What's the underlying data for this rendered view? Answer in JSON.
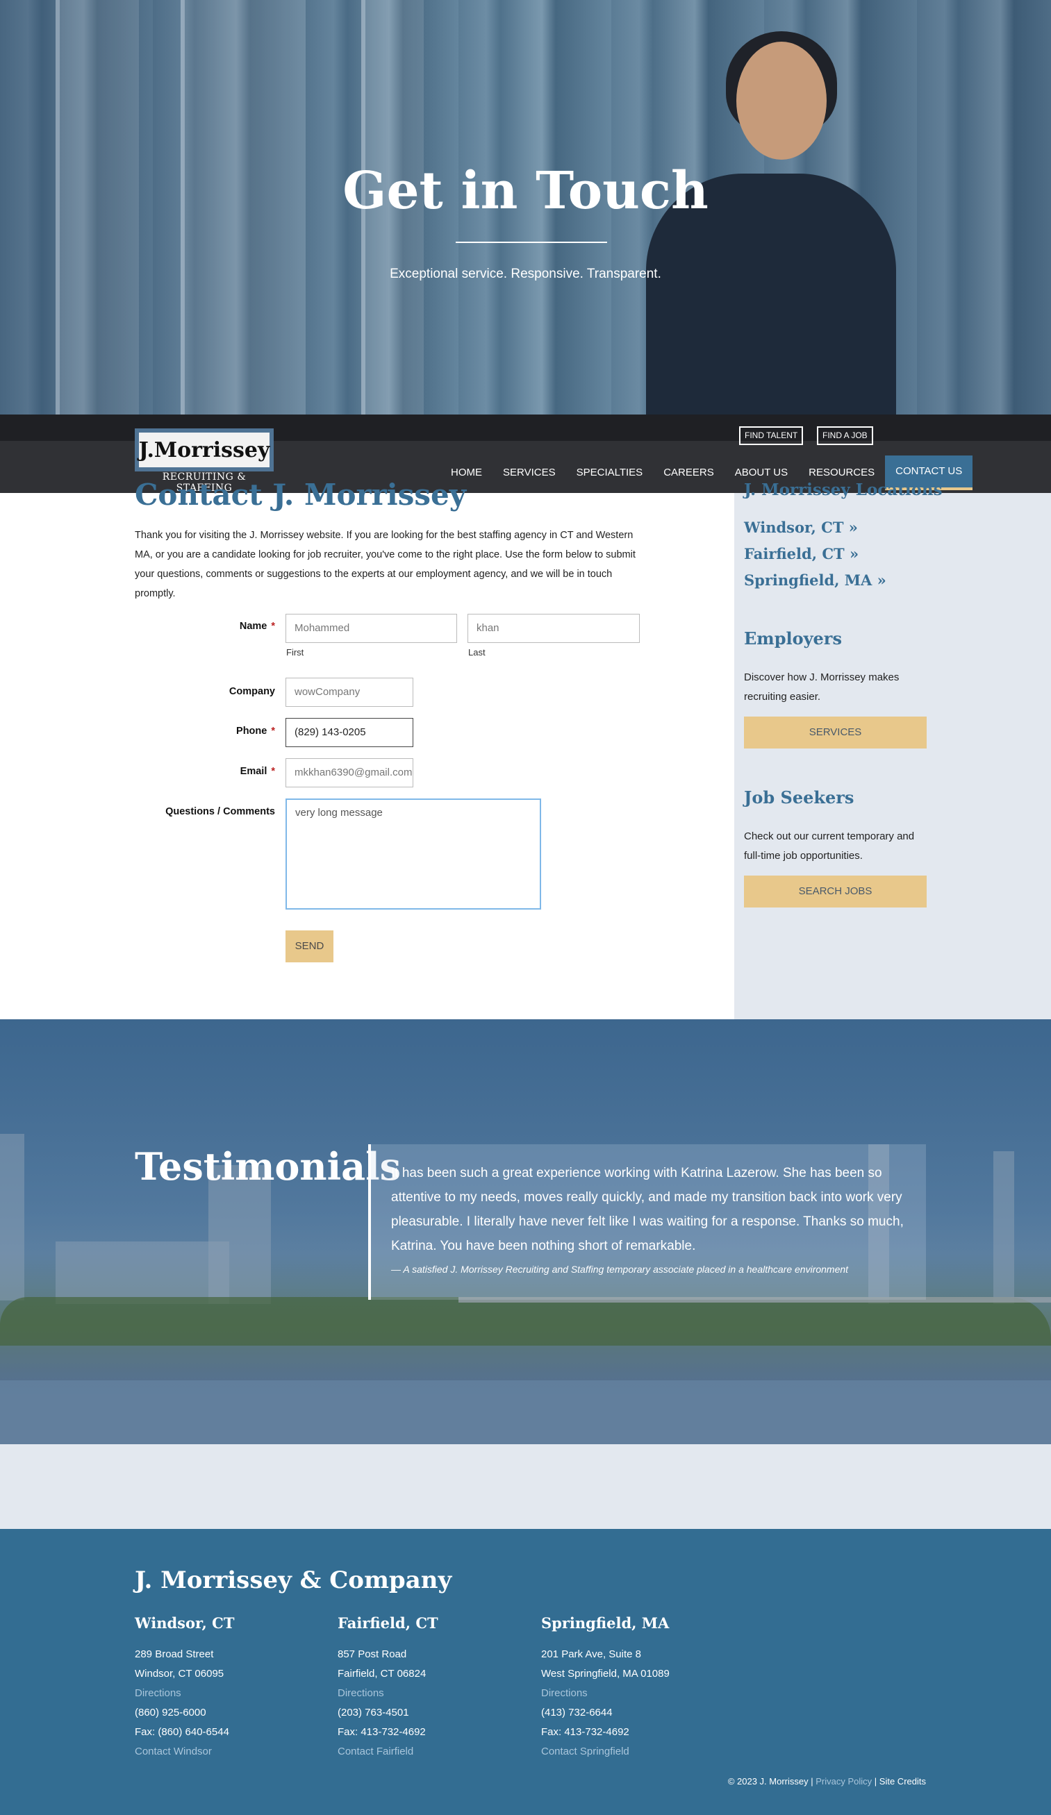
{
  "hero": {
    "title": "Get in Touch",
    "subtitle": "Exceptional service. Responsive. Transparent."
  },
  "header": {
    "logo_name": "J.Morrissey",
    "logo_tagline": "RECRUITING & STAFFING",
    "util": [
      "FIND TALENT",
      "FIND A JOB"
    ],
    "nav": [
      "HOME",
      "SERVICES",
      "SPECIALTIES",
      "CAREERS",
      "ABOUT US",
      "RESOURCES",
      "CONTACT US"
    ],
    "active_nav": "CONTACT US"
  },
  "contact": {
    "title": "Contact J. Morrissey",
    "intro": "Thank you for visiting the J. Morrissey website. If you are looking for the best staffing agency in CT and Western MA, or you are a candidate looking for job recruiter, you've come to the right place. Use the form below to submit your questions, comments or suggestions to the experts at our employment agency, and we will be in touch promptly.",
    "form": {
      "name_label": "Name",
      "required_mark": "*",
      "first_value": "Mohammed",
      "last_value": "khan",
      "first_sub": "First",
      "last_sub": "Last",
      "company_label": "Company",
      "company_value": "wowCompany",
      "phone_label": "Phone",
      "phone_value": "(829) 143-0205",
      "email_label": "Email",
      "email_value": "mkkhan6390@gmail.com",
      "comments_label": "Questions / Comments",
      "comments_value": "very long message",
      "send_label": "SEND"
    }
  },
  "sidebar": {
    "locations_title": "J. Morrissey Locations",
    "locations": [
      "Windsor, CT »",
      "Fairfield, CT »",
      "Springfield, MA »"
    ],
    "employers_title": "Employers",
    "employers_text": "Discover how J. Morrissey makes recruiting easier.",
    "employers_button": "SERVICES",
    "seekers_title": "Job Seekers",
    "seekers_text": "Check out our current temporary and full-time job opportunities.",
    "seekers_button": "SEARCH JOBS"
  },
  "testimonials": {
    "title": "Testimonials",
    "quote": "It has been such a great experience working with Katrina Lazerow. She has been so attentive to my needs, moves really quickly, and made my transition back into work very pleasurable. I literally have never felt like I was waiting for a response. Thanks so much, Katrina. You have been nothing short of remarkable.",
    "cite": "— A satisfied J. Morrissey Recruiting and Staffing temporary associate placed in a healthcare environment"
  },
  "footer": {
    "brand": "J. Morrissey & Company",
    "offices": [
      {
        "city": "Windsor, CT",
        "street": "289 Broad Street",
        "citystate": "Windsor, CT 06095",
        "directions": "Directions",
        "phone": "(860) 925-6000",
        "fax": "Fax: (860) 640-6544",
        "contact": "Contact Windsor"
      },
      {
        "city": "Fairfield, CT",
        "street": "857 Post Road",
        "citystate": "Fairfield, CT 06824",
        "directions": "Directions",
        "phone": "(203) 763-4501",
        "fax": "Fax: 413-732-4692",
        "contact": "Contact Fairfield"
      },
      {
        "city": "Springfield, MA",
        "street": "201 Park Ave, Suite 8",
        "citystate": "West Springfield, MA 01089",
        "directions": "Directions",
        "phone": "(413) 732-6644",
        "fax": "Fax: 413-732-4692",
        "contact": "Contact Springfield"
      }
    ],
    "copyright": "© 2023 J. Morrissey |",
    "privacy": "Privacy Policy",
    "sep": "|",
    "credits": "Site Credits"
  },
  "colors": {
    "brand_blue": "#3a6f95",
    "footer_blue": "#336d92",
    "accent_gold": "#e8c88b",
    "sidebar_bg": "#e3e8ef"
  }
}
